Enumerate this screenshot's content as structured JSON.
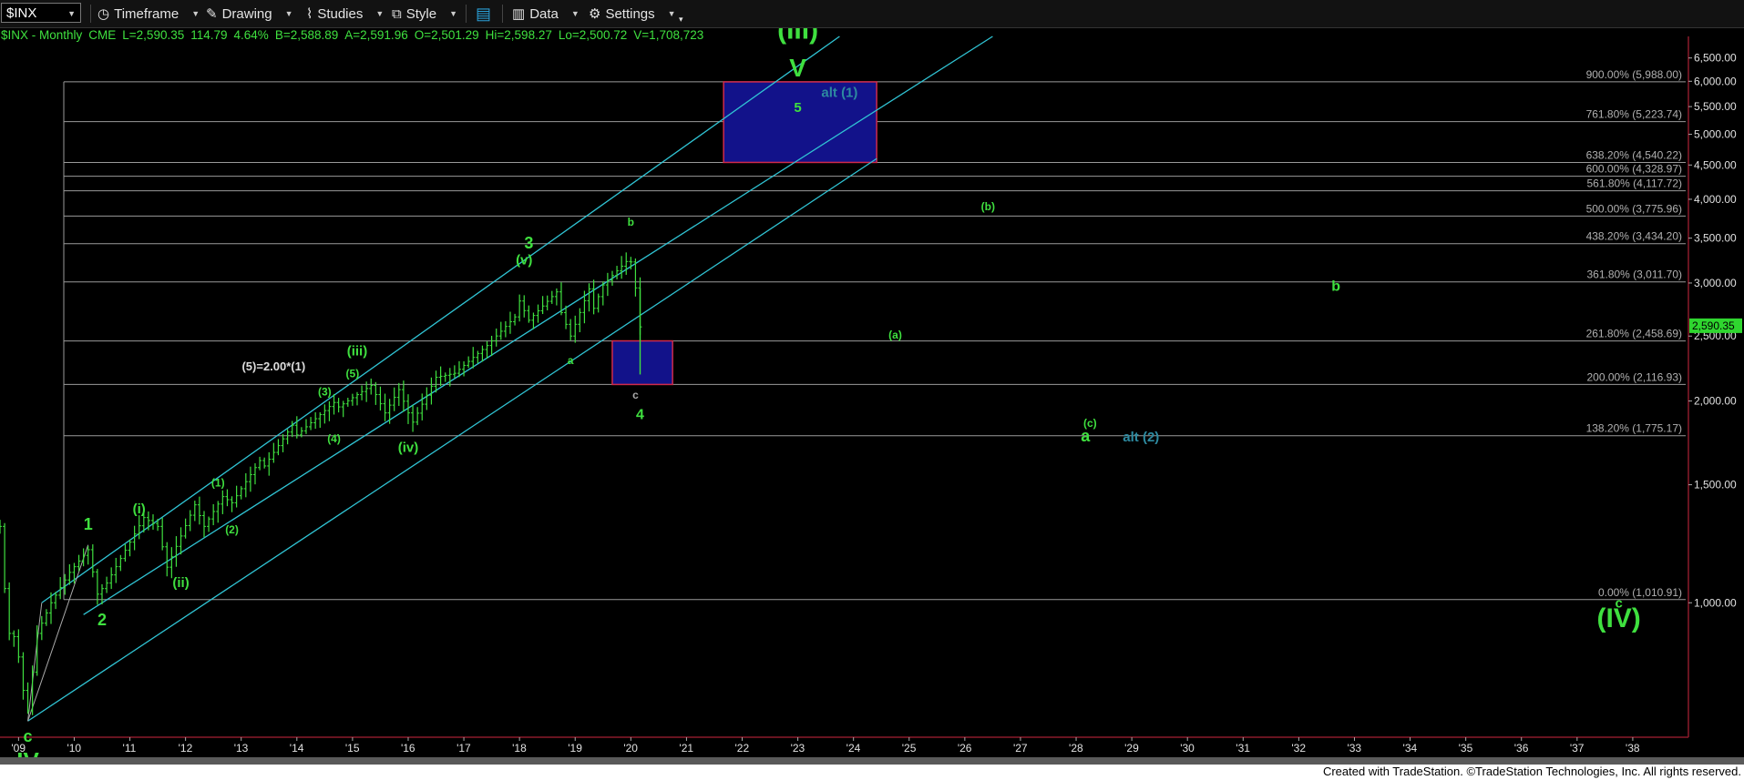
{
  "toolbar": {
    "symbol": "$INX",
    "timeframe": "Timeframe",
    "drawing": "Drawing",
    "studies": "Studies",
    "style": "Style",
    "data": "Data",
    "settings": "Settings"
  },
  "header": {
    "name": "$INX - Monthly",
    "exchange": "CME",
    "last": "L=2,590.35",
    "change": "114.79",
    "pct": "4.64%",
    "bid": "B=2,588.89",
    "ask": "A=2,591.96",
    "open": "O=2,501.29",
    "high": "Hi=2,598.27",
    "low": "Lo=2,500.72",
    "volume": "V=1,708,723"
  },
  "footer": "Created with TradeStation. ©TradeStation Technologies, Inc. All rights reserved.",
  "colors": {
    "price": "#3fe03f",
    "channel": "#30c4d4",
    "fib_line": "#9a9a9a",
    "box_fill": "#12128a",
    "box_border": "#d02a4a",
    "label_green": "#3fe03f",
    "label_alt": "#2d8aa0",
    "last_price_bg": "#2fd62f"
  },
  "chart_data": {
    "type": "ohlc",
    "y_scale": "log",
    "ylim": [
      630,
      7000
    ],
    "x_range": [
      "2008-09",
      "2039-01"
    ],
    "y_ticks": [
      1000,
      1500,
      2000,
      2500,
      3000,
      3500,
      4000,
      4500,
      5000,
      5500,
      6000,
      6500
    ],
    "y_tick_labels": [
      "1,000.00",
      "1,500.00",
      "2,000.00",
      "2,500.00",
      "3,000.00",
      "3,500.00",
      "4,000.00",
      "4,500.00",
      "5,000.00",
      "5,500.00",
      "6,000.00",
      "6,500.00"
    ],
    "x_ticks": [
      2009,
      2010,
      2011,
      2012,
      2013,
      2014,
      2015,
      2016,
      2017,
      2018,
      2019,
      2020,
      2021,
      2022,
      2023,
      2024,
      2025,
      2026,
      2027,
      2028,
      2029,
      2030,
      2031,
      2032,
      2033,
      2034,
      2035,
      2036,
      2037,
      2038
    ],
    "x_tick_labels": [
      "'09",
      "'10",
      "'11",
      "'12",
      "'13",
      "'14",
      "'15",
      "'16",
      "'17",
      "'18",
      "'19",
      "'20",
      "'21",
      "'22",
      "'23",
      "'24",
      "'25",
      "'26",
      "'27",
      "'28",
      "'29",
      "'30",
      "'31",
      "'32",
      "'33",
      "'34",
      "'35",
      "'36",
      "'37",
      "'38"
    ],
    "last_price_label": "2,590.35",
    "last_price": 2590.35,
    "price_keypoints": [
      [
        "2008-09",
        1300
      ],
      [
        "2008-10",
        1050
      ],
      [
        "2008-11",
        900
      ],
      [
        "2008-12",
        890
      ],
      [
        "2009-01",
        830
      ],
      [
        "2009-02",
        740
      ],
      [
        "2009-03",
        690
      ],
      [
        "2009-05",
        900
      ],
      [
        "2009-08",
        1000
      ],
      [
        "2009-12",
        1110
      ],
      [
        "2010-04",
        1200
      ],
      [
        "2010-06",
        1030
      ],
      [
        "2010-08",
        1070
      ],
      [
        "2011-04",
        1340
      ],
      [
        "2011-07",
        1300
      ],
      [
        "2011-09",
        1130
      ],
      [
        "2012-03",
        1400
      ],
      [
        "2012-05",
        1300
      ],
      [
        "2012-09",
        1440
      ],
      [
        "2012-11",
        1410
      ],
      [
        "2013-05",
        1630
      ],
      [
        "2013-06",
        1600
      ],
      [
        "2013-12",
        1840
      ],
      [
        "2014-01",
        1780
      ],
      [
        "2014-09",
        1990
      ],
      [
        "2014-10",
        1960
      ],
      [
        "2015-05",
        2110
      ],
      [
        "2015-08",
        1920
      ],
      [
        "2015-11",
        2080
      ],
      [
        "2016-01",
        1920
      ],
      [
        "2016-02",
        1860
      ],
      [
        "2016-07",
        2170
      ],
      [
        "2016-11",
        2200
      ],
      [
        "2017-06",
        2420
      ],
      [
        "2017-12",
        2670
      ],
      [
        "2018-01",
        2820
      ],
      [
        "2018-03",
        2640
      ],
      [
        "2018-09",
        2910
      ],
      [
        "2018-10",
        2710
      ],
      [
        "2018-12",
        2500
      ],
      [
        "2019-04",
        2940
      ],
      [
        "2019-05",
        2750
      ],
      [
        "2019-07",
        2980
      ],
      [
        "2019-12",
        3230
      ],
      [
        "2020-01",
        3225
      ],
      [
        "2020-02",
        2950
      ],
      [
        "2020-03",
        2580
      ]
    ],
    "fib_levels": [
      {
        "label": "900.00% (5,988.00)",
        "value": 5988.0
      },
      {
        "label": "761.80% (5,223.74)",
        "value": 5223.74
      },
      {
        "label": "638.20% (4,540.22)",
        "value": 4540.22
      },
      {
        "label": "600.00% (4,328.97)",
        "value": 4328.97
      },
      {
        "label": "561.80% (4,117.72)",
        "value": 4117.72
      },
      {
        "label": "500.00% (3,775.96)",
        "value": 3775.96
      },
      {
        "label": "438.20% (3,434.20)",
        "value": 3434.2
      },
      {
        "label": "361.80% (3,011.70)",
        "value": 3011.7
      },
      {
        "label": "261.80% (2,458.69)",
        "value": 2458.69
      },
      {
        "label": "200.00% (2,116.93)",
        "value": 2116.93
      },
      {
        "label": "138.20% (1,775.17)",
        "value": 1775.17
      },
      {
        "label": "0.00% (1,010.91)",
        "value": 1010.91
      }
    ],
    "channel_lines": [
      {
        "from": [
          "2009-06",
          1000
        ],
        "to": [
          "2023-10",
          7000
        ]
      },
      {
        "from": [
          "2010-03",
          960
        ],
        "to": [
          "2026-07",
          7000
        ]
      },
      {
        "from": [
          "2009-03",
          666
        ],
        "to": [
          "2024-06",
          4600
        ]
      }
    ],
    "wave_lines": [
      {
        "from": [
          "2009-03",
          666
        ],
        "to": [
          "2010-04",
          1220
        ]
      },
      {
        "from": [
          "2009-03",
          666
        ],
        "to": [
          "2009-06",
          1000
        ]
      }
    ],
    "boxes": [
      {
        "name": "target-box-v",
        "x0": "2021-09",
        "x1": "2024-06",
        "y0": 4540,
        "y1": 5988
      },
      {
        "name": "support-box-4",
        "x0": "2019-09",
        "x1": "2020-10",
        "y0": 2117,
        "y1": 2459
      }
    ],
    "labels": [
      {
        "text": "(III)",
        "x": "2023-01",
        "y": 6950,
        "size": 30,
        "color": "green"
      },
      {
        "text": "V",
        "x": "2023-01",
        "y": 6100,
        "size": 28,
        "color": "green"
      },
      {
        "text": "5",
        "x": "2023-01",
        "y": 5400,
        "size": 15,
        "color": "green"
      },
      {
        "text": "alt (1)",
        "x": "2023-10",
        "y": 5690,
        "size": 15,
        "color": "alt"
      },
      {
        "text": "3",
        "x": "2018-03",
        "y": 3380,
        "size": 18,
        "color": "green"
      },
      {
        "text": "(v)",
        "x": "2018-02",
        "y": 3200,
        "size": 15,
        "color": "green"
      },
      {
        "text": "b",
        "x": "2020-01",
        "y": 3650,
        "size": 12,
        "color": "green"
      },
      {
        "text": "a",
        "x": "2018-12",
        "y": 2270,
        "size": 12,
        "color": "green"
      },
      {
        "text": "c",
        "x": "2020-02",
        "y": 2015,
        "size": 12,
        "color": "grey"
      },
      {
        "text": "4",
        "x": "2020-03",
        "y": 1880,
        "size": 16,
        "color": "green"
      },
      {
        "text": "(5)=2.00*(1)",
        "x": "2013-08",
        "y": 2220,
        "size": 13,
        "color": "white"
      },
      {
        "text": "(iii)",
        "x": "2015-02",
        "y": 2340,
        "size": 15,
        "color": "green"
      },
      {
        "text": "(5)",
        "x": "2015-01",
        "y": 2170,
        "size": 12,
        "color": "green"
      },
      {
        "text": "(3)",
        "x": "2014-07",
        "y": 2040,
        "size": 12,
        "color": "green"
      },
      {
        "text": "(4)",
        "x": "2014-09",
        "y": 1735,
        "size": 12,
        "color": "green"
      },
      {
        "text": "(iv)",
        "x": "2016-01",
        "y": 1680,
        "size": 15,
        "color": "green"
      },
      {
        "text": "(1)",
        "x": "2012-08",
        "y": 1490,
        "size": 12,
        "color": "green"
      },
      {
        "text": "(2)",
        "x": "2012-11",
        "y": 1270,
        "size": 12,
        "color": "green"
      },
      {
        "text": "(i)",
        "x": "2011-03",
        "y": 1360,
        "size": 15,
        "color": "green"
      },
      {
        "text": "(ii)",
        "x": "2011-12",
        "y": 1055,
        "size": 15,
        "color": "green"
      },
      {
        "text": "1",
        "x": "2010-04",
        "y": 1285,
        "size": 18,
        "color": "green"
      },
      {
        "text": "2",
        "x": "2010-07",
        "y": 925,
        "size": 18,
        "color": "green"
      },
      {
        "text": "c",
        "x": "2009-03",
        "y": 620,
        "size": 18,
        "color": "green"
      },
      {
        "text": "IV",
        "x": "2009-03",
        "y": 565,
        "size": 26,
        "color": "green"
      },
      {
        "text": "(b)",
        "x": "2026-06",
        "y": 3850,
        "size": 12,
        "color": "green"
      },
      {
        "text": "b",
        "x": "2032-09",
        "y": 2920,
        "size": 16,
        "color": "green"
      },
      {
        "text": "(a)",
        "x": "2024-10",
        "y": 2480,
        "size": 12,
        "color": "green"
      },
      {
        "text": "(c)",
        "x": "2028-04",
        "y": 1830,
        "size": 12,
        "color": "green"
      },
      {
        "text": "a",
        "x": "2028-03",
        "y": 1740,
        "size": 18,
        "color": "green"
      },
      {
        "text": "alt (2)",
        "x": "2029-03",
        "y": 1740,
        "size": 15,
        "color": "alt"
      },
      {
        "text": "c",
        "x": "2037-10",
        "y": 983,
        "size": 15,
        "color": "green"
      },
      {
        "text": "(IV)",
        "x": "2037-10",
        "y": 920,
        "size": 30,
        "color": "green"
      }
    ]
  }
}
